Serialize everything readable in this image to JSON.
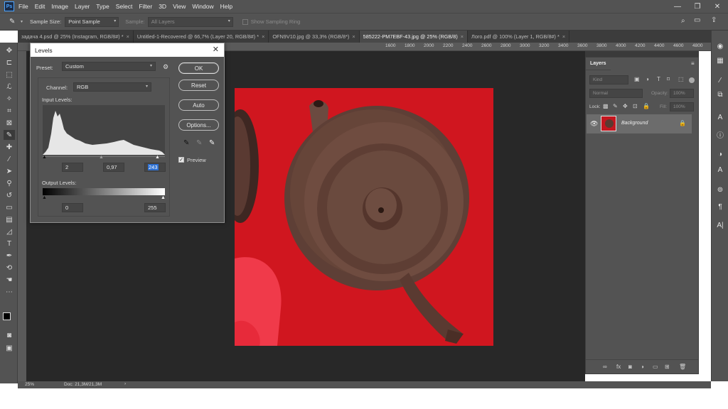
{
  "menubar": {
    "logo": "Ps",
    "items": [
      "File",
      "Edit",
      "Image",
      "Layer",
      "Type",
      "Select",
      "Filter",
      "3D",
      "View",
      "Window",
      "Help"
    ]
  },
  "window_controls": {
    "minimize": "—",
    "restore": "❐",
    "close": "✕"
  },
  "options_bar": {
    "sample_size_label": "Sample Size:",
    "sample_size_value": "Point Sample",
    "sample_label": "Sample:",
    "sample_value": "All Layers",
    "show_ring_label": "Show Sampling Ring"
  },
  "tabs": [
    {
      "label": "задача 4.psd @ 25% (Instagram, RGB/8#) *",
      "active": false
    },
    {
      "label": "Untitled-1-Recovered @ 66,7% (Layer 20, RGB/8#) *",
      "active": false
    },
    {
      "label": "OFN9V10.jpg @ 33,3% (RGB/8*)",
      "active": false
    },
    {
      "label": "585222-PM7EBF-43.jpg @ 25% (RGB/8)",
      "active": true
    },
    {
      "label": "Лого.pdf @ 100% (Layer 1, RGB/8#) *",
      "active": false
    }
  ],
  "ruler_labels": [
    "1600",
    "1800",
    "2000",
    "2200",
    "2400",
    "2600",
    "2800",
    "3000",
    "3200",
    "3400",
    "3600",
    "3800",
    "4000",
    "4200",
    "4400",
    "4600",
    "4800"
  ],
  "statusbar": {
    "zoom": "25%",
    "doc": "Doc: 21,3M/21,3M"
  },
  "layers_panel": {
    "title": "Layers",
    "kind_placeholder": "Kind",
    "blend_mode": "Normal",
    "opacity_label": "Opacity:",
    "opacity_value": "100%",
    "lock_label": "Lock:",
    "fill_label": "Fill:",
    "fill_value": "100%",
    "layer_name": "Background"
  },
  "levels": {
    "title": "Levels",
    "preset_label": "Preset:",
    "preset_value": "Custom",
    "channel_label": "Channel:",
    "channel_value": "RGB",
    "input_levels_label": "Input Levels:",
    "input_black": "2",
    "input_gamma": "0,97",
    "input_white": "243",
    "output_levels_label": "Output Levels:",
    "output_black": "0",
    "output_white": "255",
    "buttons": {
      "ok": "OK",
      "reset": "Reset",
      "auto": "Auto",
      "options": "Options..."
    },
    "preview_label": "Preview",
    "preview_checked": true
  }
}
